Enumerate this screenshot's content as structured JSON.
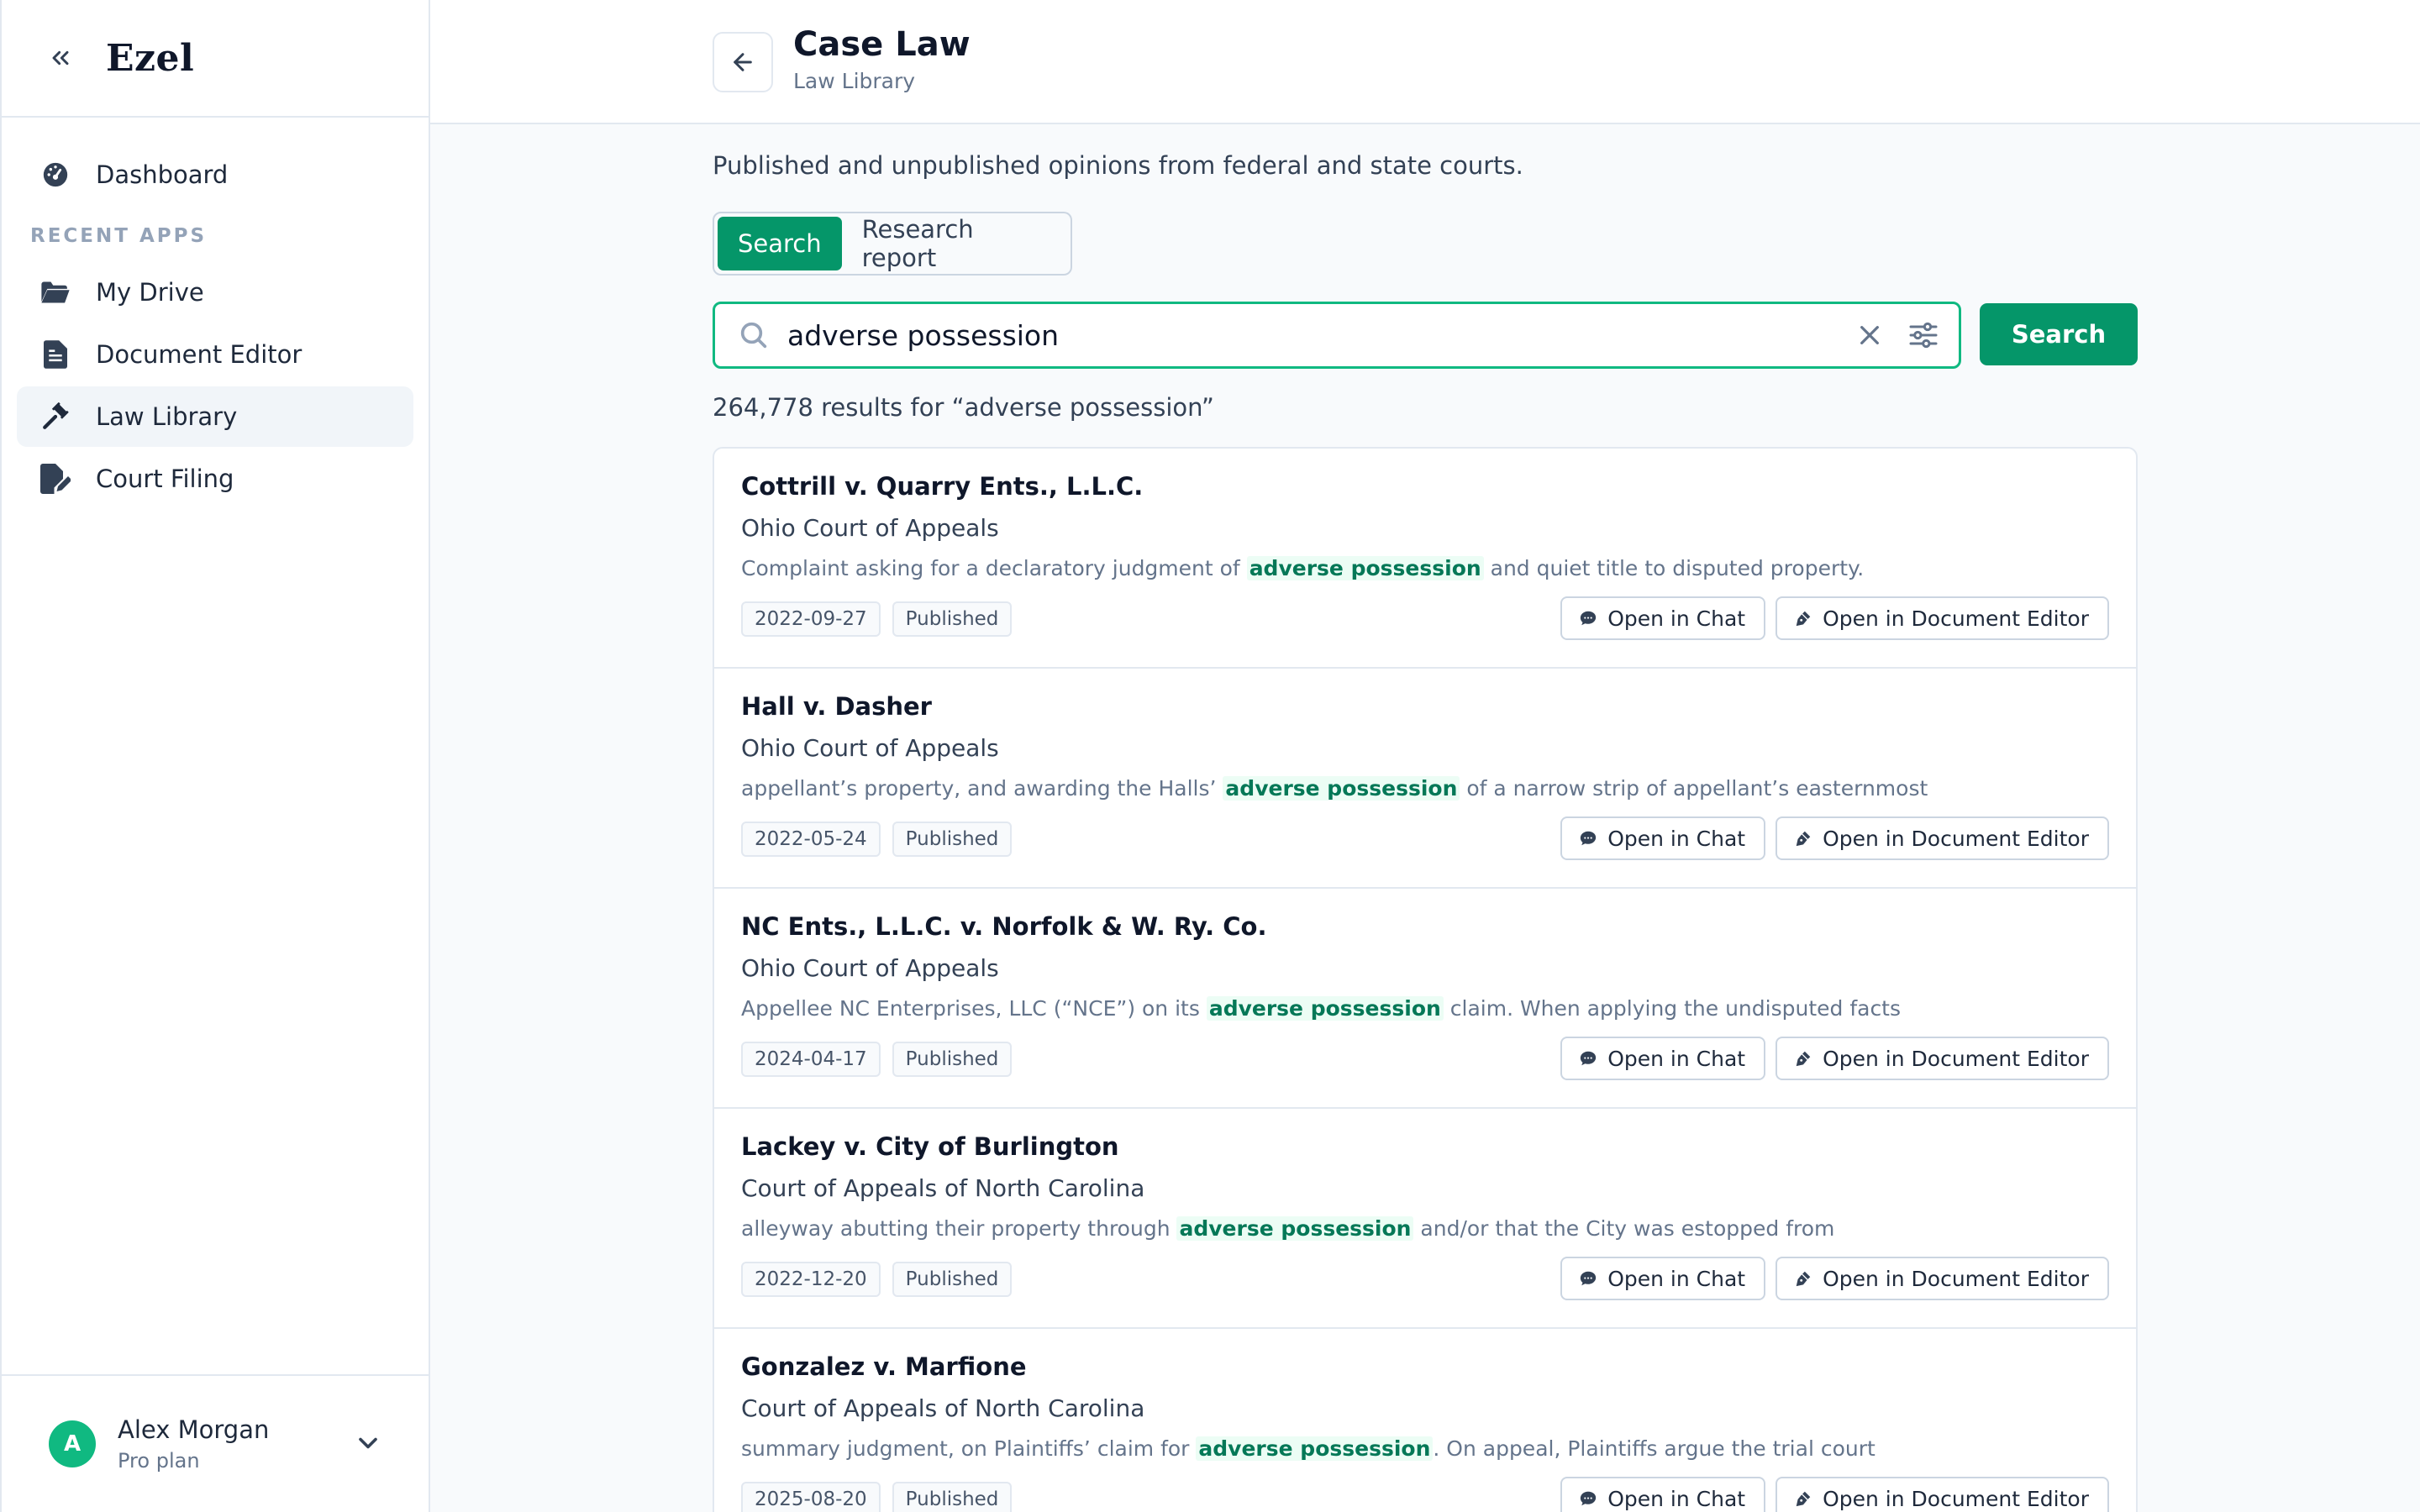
{
  "app": {
    "brand": "Ezel"
  },
  "sidebar": {
    "dashboard": "Dashboard",
    "section_label": "RECENT APPS",
    "items": [
      {
        "label": "My Drive",
        "icon": "folder-icon"
      },
      {
        "label": "Document Editor",
        "icon": "document-icon"
      },
      {
        "label": "Law Library",
        "icon": "gavel-icon",
        "active": true
      },
      {
        "label": "Court Filing",
        "icon": "file-edit-icon"
      }
    ],
    "user": {
      "initial": "A",
      "name": "Alex Morgan",
      "plan": "Pro plan"
    }
  },
  "header": {
    "title": "Case Law",
    "subtitle": "Law Library"
  },
  "main": {
    "description": "Published and unpublished opinions from federal and state courts.",
    "tabs": [
      "Search",
      "Research report"
    ],
    "active_tab": "Search",
    "search": {
      "value": "adverse possession",
      "button": "Search"
    },
    "result_count": "264,778 results for “adverse possession”",
    "actions": {
      "chat": "Open in Chat",
      "editor": "Open in Document Editor"
    },
    "results": [
      {
        "title": "Cottrill v. Quarry Ents., L.L.C.",
        "court": "Ohio Court of Appeals",
        "snippet_before": "Complaint asking for a declaratory judgment of ",
        "snippet_highlight": "adverse possession",
        "snippet_after": " and quiet title to disputed property.",
        "date": "2022-09-27",
        "status": "Published"
      },
      {
        "title": "Hall v. Dasher",
        "court": "Ohio Court of Appeals",
        "snippet_before": "appellant’s property, and awarding the Halls’ ",
        "snippet_highlight": "adverse possession",
        "snippet_after": " of a narrow strip of appellant’s easternmost",
        "date": "2022-05-24",
        "status": "Published"
      },
      {
        "title": "NC Ents., L.L.C. v. Norfolk & W. Ry. Co.",
        "court": "Ohio Court of Appeals",
        "snippet_before": "Appellee NC Enterprises, LLC (“NCE”) on its ",
        "snippet_highlight": "adverse possession",
        "snippet_after": " claim. When applying the undisputed facts",
        "date": "2024-04-17",
        "status": "Published"
      },
      {
        "title": "Lackey v. City of Burlington",
        "court": "Court of Appeals of North Carolina",
        "snippet_before": "alleyway abutting their property through ",
        "snippet_highlight": "adverse possession",
        "snippet_after": " and/or that the City was estopped from",
        "date": "2022-12-20",
        "status": "Published"
      },
      {
        "title": "Gonzalez v. Marfione",
        "court": "Court of Appeals of North Carolina",
        "snippet_before": "summary judgment, on Plaintiffs’ claim for ",
        "snippet_highlight": "adverse possession",
        "snippet_after": ". On appeal, Plaintiffs argue the trial court",
        "date": "2025-08-20",
        "status": "Published"
      }
    ]
  },
  "colors": {
    "accent": "#059669",
    "highlight_bg": "#ecfdf5",
    "highlight_text": "#047857"
  }
}
